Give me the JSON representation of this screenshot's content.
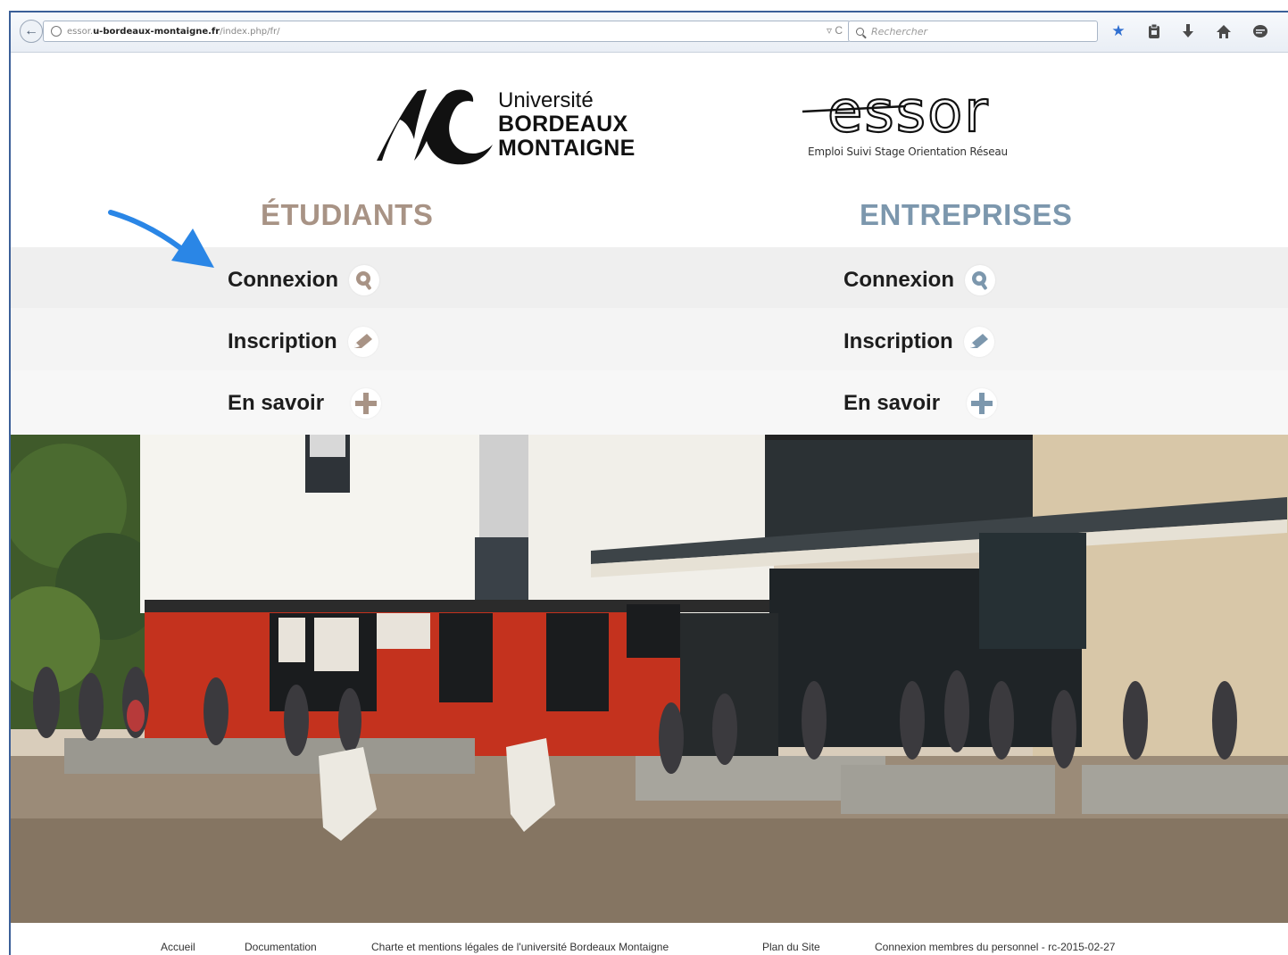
{
  "browser": {
    "url_prefix": "essor.",
    "url_domain": "u-bordeaux-montaigne.fr",
    "url_path": "/index.php/fr/",
    "url_tail_icons": "▿ C",
    "search_placeholder": "Rechercher",
    "toolbar_icons": [
      "star-icon",
      "clipboard-icon",
      "download-icon",
      "home-icon",
      "chat-icon"
    ]
  },
  "header": {
    "university": {
      "line1": "Université",
      "line2": "BORDEAUX",
      "line3": "MONTAIGNE"
    },
    "essor": {
      "logo_text": "essor",
      "tagline": "Emploi Suivi Stage Orientation Réseau"
    }
  },
  "etudiants": {
    "title": "ÉTUDIANTS",
    "color": "#a89385",
    "links": [
      {
        "label": "Connexion",
        "icon": "search-icon"
      },
      {
        "label": "Inscription",
        "icon": "pencil-icon"
      },
      {
        "label": "En savoir",
        "icon": "plus-icon"
      }
    ]
  },
  "entreprises": {
    "title": "ENTREPRISES",
    "color": "#7c97ad",
    "links": [
      {
        "label": "Connexion",
        "icon": "search-icon"
      },
      {
        "label": "Inscription",
        "icon": "pencil-icon"
      },
      {
        "label": "En savoir",
        "icon": "plus-icon"
      }
    ]
  },
  "annotation": {
    "color": "#2a86e6"
  },
  "footer": {
    "links": [
      "Accueil",
      "Documentation",
      "Charte et mentions légales de l'université Bordeaux Montaigne",
      "Plan du Site",
      "Connexion membres du personnel - rc-2015-02-27"
    ]
  }
}
